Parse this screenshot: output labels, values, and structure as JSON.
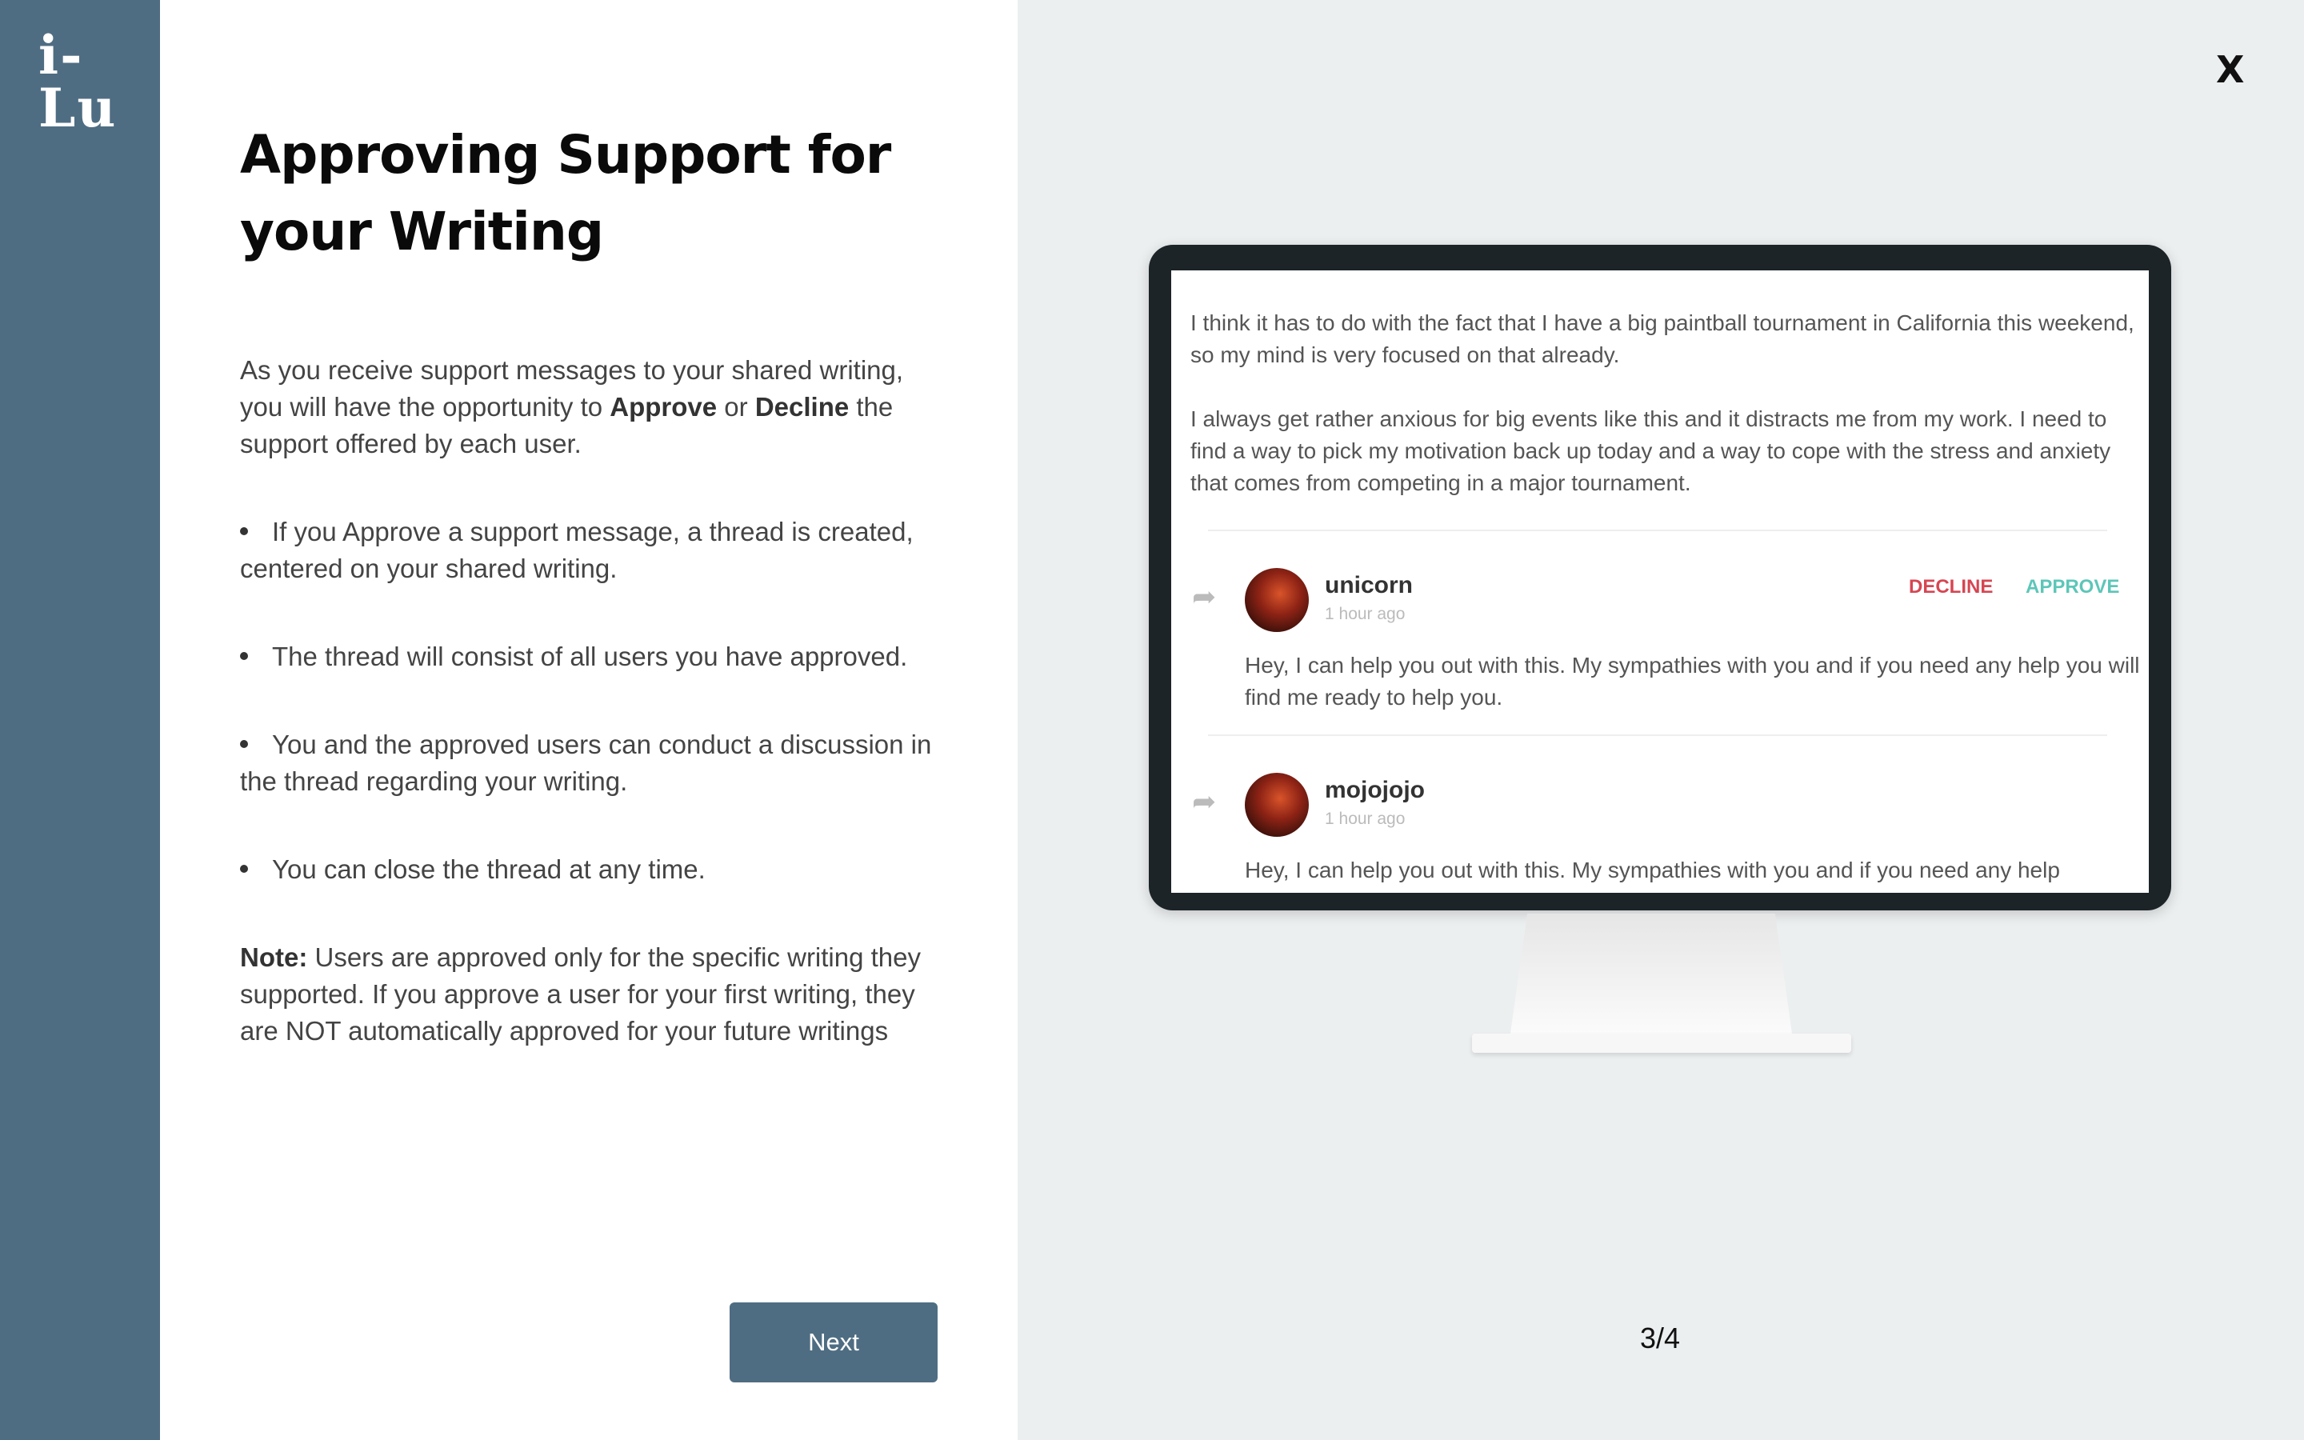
{
  "brand": {
    "logo": "i-Lu",
    "sidebar_color": "#4f6d82"
  },
  "left": {
    "title": "Approving Support for your Writing",
    "intro": {
      "part1": "As you receive support messages to your shared writing, you will have the opportunity to ",
      "approve": "Approve",
      "or": " or ",
      "decline": "Decline",
      "part2": " the support offered by each user."
    },
    "bullets": [
      "If you Approve a support message, a thread is created, centered on your shared writing.",
      "The thread will consist of all users you have approved.",
      "You and the approved users can conduct a discussion in the thread regarding your writing.",
      "You can close the thread at any time."
    ],
    "note": {
      "label": "Note:",
      "text": " Users are approved only for the specific writing they supported. If you approve a user for your first writing, they are NOT automatically approved for your future writings"
    },
    "next_label": "Next"
  },
  "right": {
    "close_label": "X",
    "pager": "3/4",
    "screen": {
      "para1": "I think it has to do with the fact that I have a big paintball tournament in California this weekend, so my mind is very focused on that already.",
      "para2": "I always get rather anxious for big events like this and it distracts me from my work. I need to find a way to pick my motivation back up today and a way to cope with the stress and anxiety that comes from competing in a major tournament.",
      "decline_label": "DECLINE",
      "approve_label": "APPROVE",
      "messages": [
        {
          "user": "unicorn",
          "time": "1 hour ago",
          "text": "Hey, I can help you out with this. My sympathies with you and if you need any help you will find me ready to help you."
        },
        {
          "user": "mojojojo",
          "time": "1 hour ago",
          "text": "Hey, I can help you out with this. My sympathies with you and if you need any help"
        }
      ]
    }
  }
}
